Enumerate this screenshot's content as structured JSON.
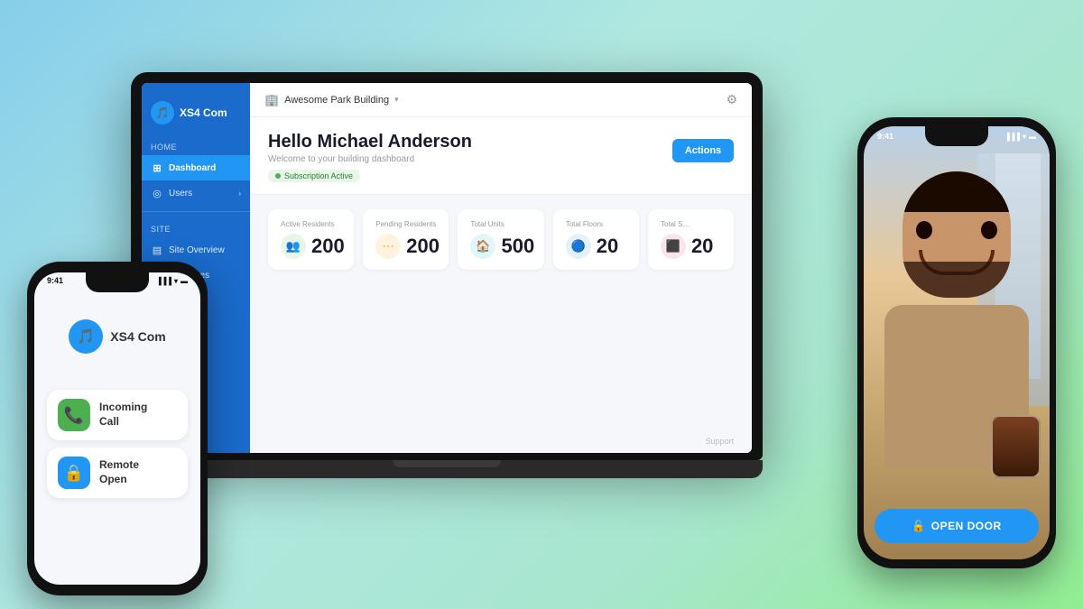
{
  "background": "#a8dde8",
  "laptop": {
    "sidebar": {
      "app_name": "XS4 Com",
      "home_label": "Home",
      "nav_items": [
        {
          "id": "dashboard",
          "label": "Dashboard",
          "active": true,
          "icon": "⊞"
        },
        {
          "id": "users",
          "label": "Users",
          "active": false,
          "icon": "◎",
          "has_arrow": true
        }
      ],
      "site_section": "Site",
      "site_items": [
        {
          "id": "site-overview",
          "label": "Site Overview",
          "icon": "▤"
        },
        {
          "id": "entrances",
          "label": "Entrances",
          "icon": "⊡"
        }
      ]
    },
    "topbar": {
      "building_name": "Awesome Park Building",
      "gear_label": "Settings"
    },
    "welcome": {
      "title": "Hello Michael Anderson",
      "subtitle": "Welcome to your building dashboard",
      "subscription": "Subscription Active",
      "actions_button": "Actions"
    },
    "stats": [
      {
        "id": "active-residents",
        "label": "Active Residents",
        "value": "200",
        "icon_type": "green"
      },
      {
        "id": "pending-residents",
        "label": "Pending Residents",
        "value": "200",
        "icon_type": "orange"
      },
      {
        "id": "total-units",
        "label": "Total Units",
        "value": "500",
        "icon_type": "teal"
      },
      {
        "id": "total-floors",
        "label": "Total Floors",
        "value": "20",
        "icon_type": "blue"
      },
      {
        "id": "total-extra",
        "label": "Total S…",
        "value": "20",
        "icon_type": "red"
      }
    ],
    "footer": "Support"
  },
  "phone_left": {
    "time": "9:41",
    "signal": "●●●",
    "wifi": "▾",
    "battery": "■",
    "app_name": "XS4 Com",
    "notifications": [
      {
        "id": "incoming-call",
        "title": "Incoming Call",
        "icon_type": "green",
        "icon": "📞"
      },
      {
        "id": "remote-open",
        "title": "Remote Open",
        "icon_type": "blue",
        "icon": "🔒"
      }
    ]
  },
  "phone_right": {
    "time": "9:41",
    "signal": "●●●",
    "wifi": "▾",
    "battery": "■",
    "open_door_label": "OPEN DOOR",
    "lock_icon": "🔓"
  }
}
